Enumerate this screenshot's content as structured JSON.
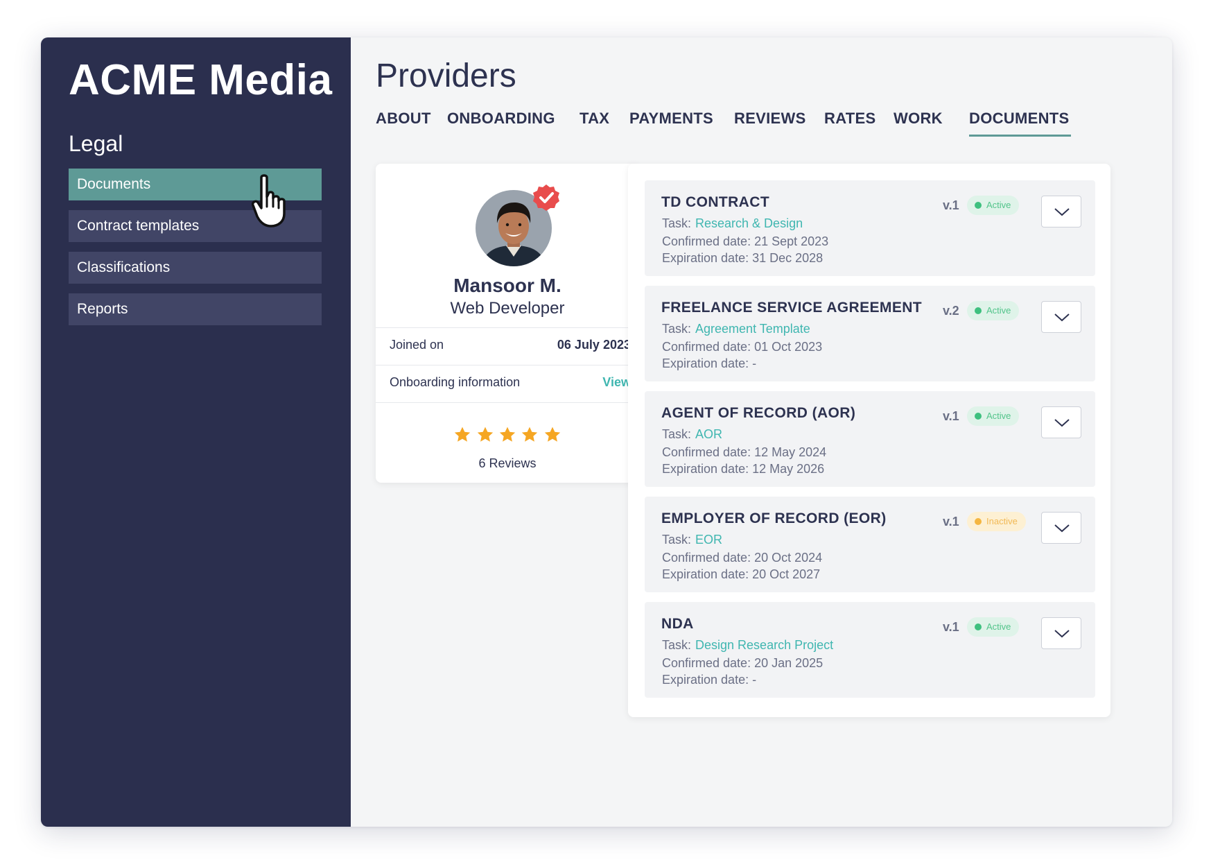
{
  "app": {
    "brand": "ACME Media"
  },
  "sidebar": {
    "section_title": "Legal",
    "items": [
      {
        "label": "Documents",
        "active": true
      },
      {
        "label": "Contract templates",
        "active": false
      },
      {
        "label": "Classifications",
        "active": false
      },
      {
        "label": "Reports",
        "active": false
      }
    ]
  },
  "main": {
    "title": "Providers",
    "tabs": [
      {
        "label": "ABOUT"
      },
      {
        "label": "ONBOARDING"
      },
      {
        "label": "TAX"
      },
      {
        "label": "PAYMENTS"
      },
      {
        "label": "REVIEWS"
      },
      {
        "label": "RATES"
      },
      {
        "label": "WORK"
      },
      {
        "label": "DOCUMENTS",
        "active": true
      }
    ]
  },
  "profile": {
    "name": "Mansoor M.",
    "role": "Web Developer",
    "joined_label": "Joined on",
    "joined_value": "06 July 2023",
    "onboarding_label": "Onboarding information",
    "onboarding_link": "View",
    "rating_stars": 5,
    "reviews": "6 Reviews"
  },
  "documents": [
    {
      "title": "TD CONTRACT",
      "task_label": "Task:",
      "task": "Research & Design",
      "confirmed": "Confirmed date:  21 Sept 2023",
      "expiration": "Expiration date: 31 Dec 2028",
      "version": "v.1",
      "status": "Active"
    },
    {
      "title": "FREELANCE SERVICE AGREEMENT",
      "task_label": "Task:",
      "task": "Agreement Template",
      "confirmed": "Confirmed date:  01 Oct 2023",
      "expiration": "Expiration date: -",
      "version": "v.2",
      "status": "Active"
    },
    {
      "title": "AGENT OF RECORD (AOR)",
      "task_label": "Task:",
      "task": "AOR",
      "confirmed": "Confirmed date:  12 May 2024",
      "expiration": "Expiration date: 12 May 2026",
      "version": "v.1",
      "status": "Active"
    },
    {
      "title": "EMPLOYER OF RECORD (EOR)",
      "task_label": "Task:",
      "task": "EOR",
      "confirmed": "Confirmed date:  20 Oct 2024",
      "expiration": "Expiration date: 20 Oct 2027",
      "version": "v.1",
      "status": "Inactive"
    },
    {
      "title": "NDA",
      "task_label": "Task:",
      "task": "Design Research Project",
      "confirmed": "Confirmed date:  20 Jan 2025",
      "expiration": "Expiration date: -",
      "version": "v.1",
      "status": "Active"
    }
  ],
  "colors": {
    "sidebar_bg": "#2b2f4e",
    "accent": "#5e9a96",
    "link": "#3fb6b0",
    "active_badge": "#3ec07f",
    "inactive_badge": "#f5b640",
    "star": "#f5a623",
    "verified": "#e84c4c"
  }
}
